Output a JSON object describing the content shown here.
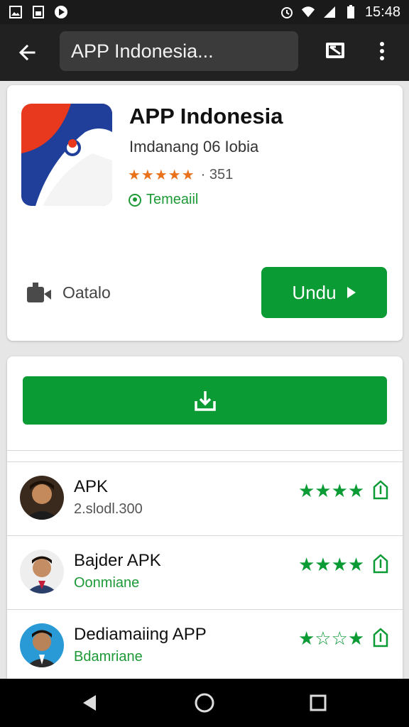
{
  "status_bar": {
    "time": "15:48",
    "icons": [
      "gallery-icon",
      "sim-card-icon",
      "play-store-icon",
      "alarm-icon",
      "wifi-icon",
      "signal-icon",
      "battery-icon"
    ]
  },
  "toolbar": {
    "search_text": "APP Indonesia...",
    "back_icon": "arrow-back-icon",
    "cast_icon": "cast-icon",
    "more_icon": "more-vert-icon"
  },
  "app": {
    "name": "APP Indonesia",
    "developer": "Imdanang 06 Iobia",
    "stars": "★★★★★",
    "rating_count": "· 351",
    "tag": "Temeaiil",
    "detail_label": "Oatalo",
    "install_label": "Undu",
    "icon_colors": {
      "red": "#e8391f",
      "blue": "#1f3f9a"
    }
  },
  "download_button": {
    "icon": "download-icon"
  },
  "list_items": [
    {
      "title": "APK",
      "subtitle": "2.slodl.300",
      "subtitle_color": "gray",
      "stars": "★★★★",
      "avatar": "avatar-1"
    },
    {
      "title": "Bajder APK",
      "subtitle": "Oonmiane",
      "subtitle_color": "green",
      "stars": "★★★★",
      "avatar": "avatar-2"
    },
    {
      "title": "Dediamaiing APP",
      "subtitle": "Bdamriane",
      "subtitle_color": "green",
      "stars": "★☆☆★",
      "avatar": "avatar-3"
    }
  ],
  "colors": {
    "accent": "#0a9b35",
    "toolbar": "#212121",
    "star_orange": "#e8711a"
  }
}
